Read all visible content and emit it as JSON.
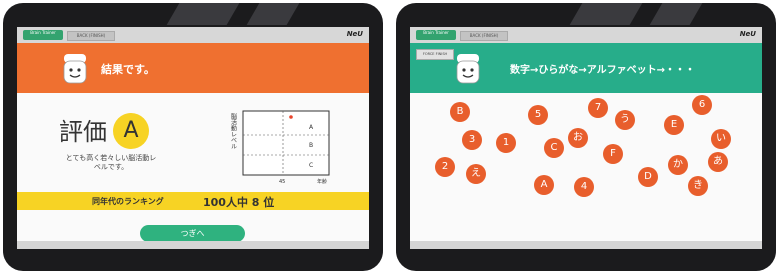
{
  "left_screen": {
    "brand_button": "Brain Trainer",
    "back_button": "BACK (FINISH)",
    "logo": "NeU",
    "header_color": "#ef7030",
    "header_title": "結果です。",
    "grade_label": "評価",
    "grade": "A",
    "description": "とても高く若々しい脳活動レベルです。",
    "chart": {
      "ylabel": "脳活動レベル",
      "x_ticks": [
        "45",
        "年齢"
      ],
      "zones": [
        "A",
        "B",
        "C"
      ],
      "marker_color": "#e8452c"
    },
    "ranking_label": "同年代のランキング",
    "ranking_value": "100人中 8 位",
    "next_button": "つぎへ"
  },
  "right_screen": {
    "brand_button": "Brain Trainer",
    "back_button": "BACK (FINISH)",
    "logo": "NeU",
    "force_button": "FORCE FINISH",
    "header_color": "#27ad8a",
    "header_title": "数字→ひらがな→アルファベット→・・・",
    "bubbles": [
      "B",
      "5",
      "7",
      "6",
      "う",
      "E",
      "い",
      "3",
      "1",
      "C",
      "お",
      "F",
      "あ",
      "2",
      "え",
      "A",
      "4",
      "D",
      "か",
      "き"
    ]
  }
}
